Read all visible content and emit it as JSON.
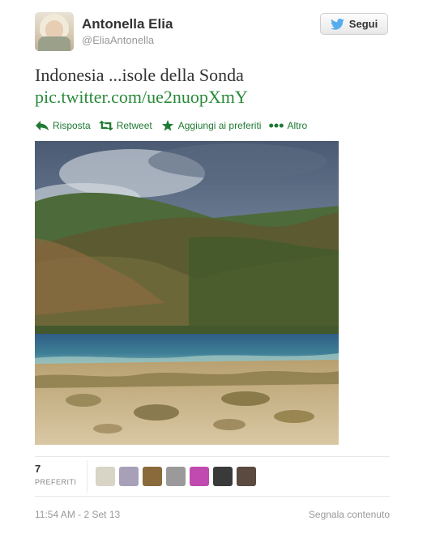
{
  "user": {
    "display_name": "Antonella Elia",
    "handle": "@EliaAntonella",
    "avatar_icon": "profile-photo"
  },
  "follow_button": {
    "label": "Segui",
    "icon": "twitter-bird-icon",
    "bird_color": "#55acee"
  },
  "tweet": {
    "text": "Indonesia ...isole della Sonda",
    "link": "pic.twitter.com/ue2nuopXmY"
  },
  "actions": [
    {
      "label": "Risposta",
      "icon": "reply-arrow-icon"
    },
    {
      "label": "Retweet",
      "icon": "retweet-icon"
    },
    {
      "label": "Aggiungi ai preferiti",
      "icon": "star-icon"
    },
    {
      "label": "Altro",
      "icon": "more-dots-icon"
    }
  ],
  "stats": {
    "favorites_count": "7",
    "favorites_label": "PREFERITI",
    "favoriters": [
      {
        "icon": "user-avatar",
        "color": "#d8d4c6"
      },
      {
        "icon": "user-avatar",
        "color": "#a8a0b8"
      },
      {
        "icon": "user-avatar",
        "color": "#8a6a3a"
      },
      {
        "icon": "user-avatar",
        "color": "#9a9a9a"
      },
      {
        "icon": "user-avatar",
        "color": "#c04ab0"
      },
      {
        "icon": "user-avatar",
        "color": "#3a3a3a"
      },
      {
        "icon": "user-avatar",
        "color": "#5a4a40"
      }
    ]
  },
  "footer": {
    "timestamp": "11:54 AM - 2 Set 13",
    "report_label": "Segnala contenuto"
  },
  "colors": {
    "link_green": "#2a8a3a",
    "action_green": "#1f7a33"
  }
}
